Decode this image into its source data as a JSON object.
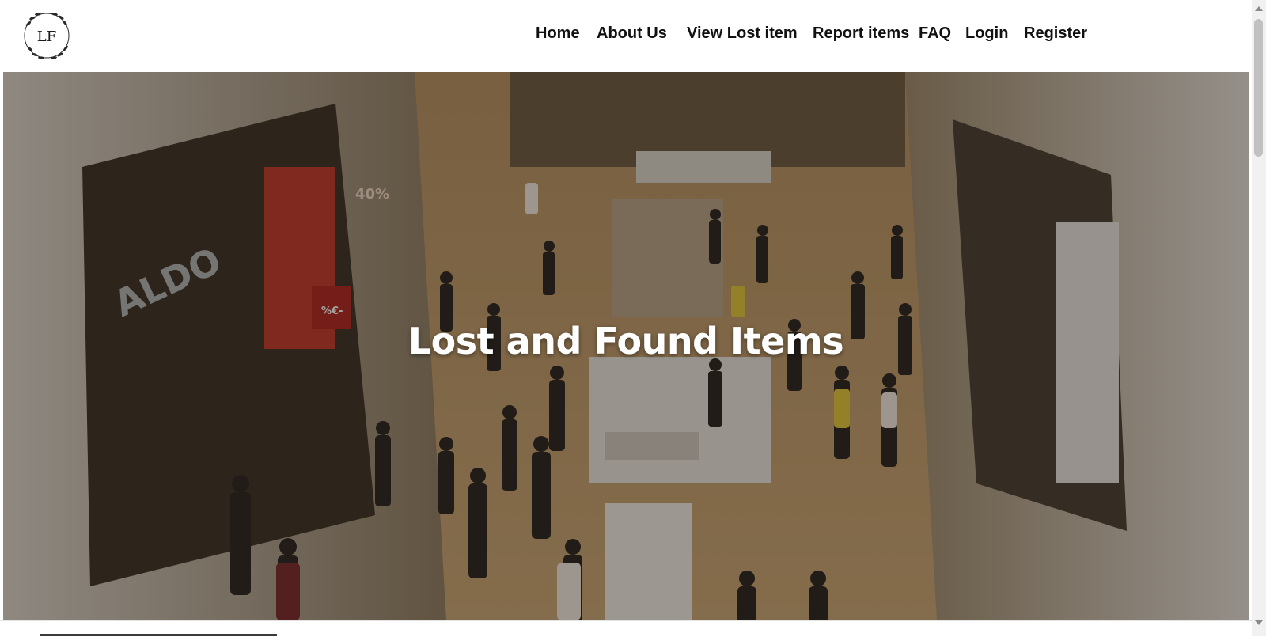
{
  "logo": {
    "initials": "LF"
  },
  "nav": {
    "items": [
      {
        "label": "Home"
      },
      {
        "label": "About Us"
      },
      {
        "label": "View Lost item"
      },
      {
        "label": "Report items"
      },
      {
        "label": "FAQ"
      },
      {
        "label": "Login"
      },
      {
        "label": "Register"
      }
    ]
  },
  "hero": {
    "title": "Lost and Found Items",
    "image_description_icon": "mall-crowd-photo",
    "store_signs": [
      "ALDO",
      "40%",
      "%€-"
    ]
  },
  "colors": {
    "nav_text": "#111111",
    "hero_title": "#ffffff",
    "page_background": "#ffffff"
  }
}
